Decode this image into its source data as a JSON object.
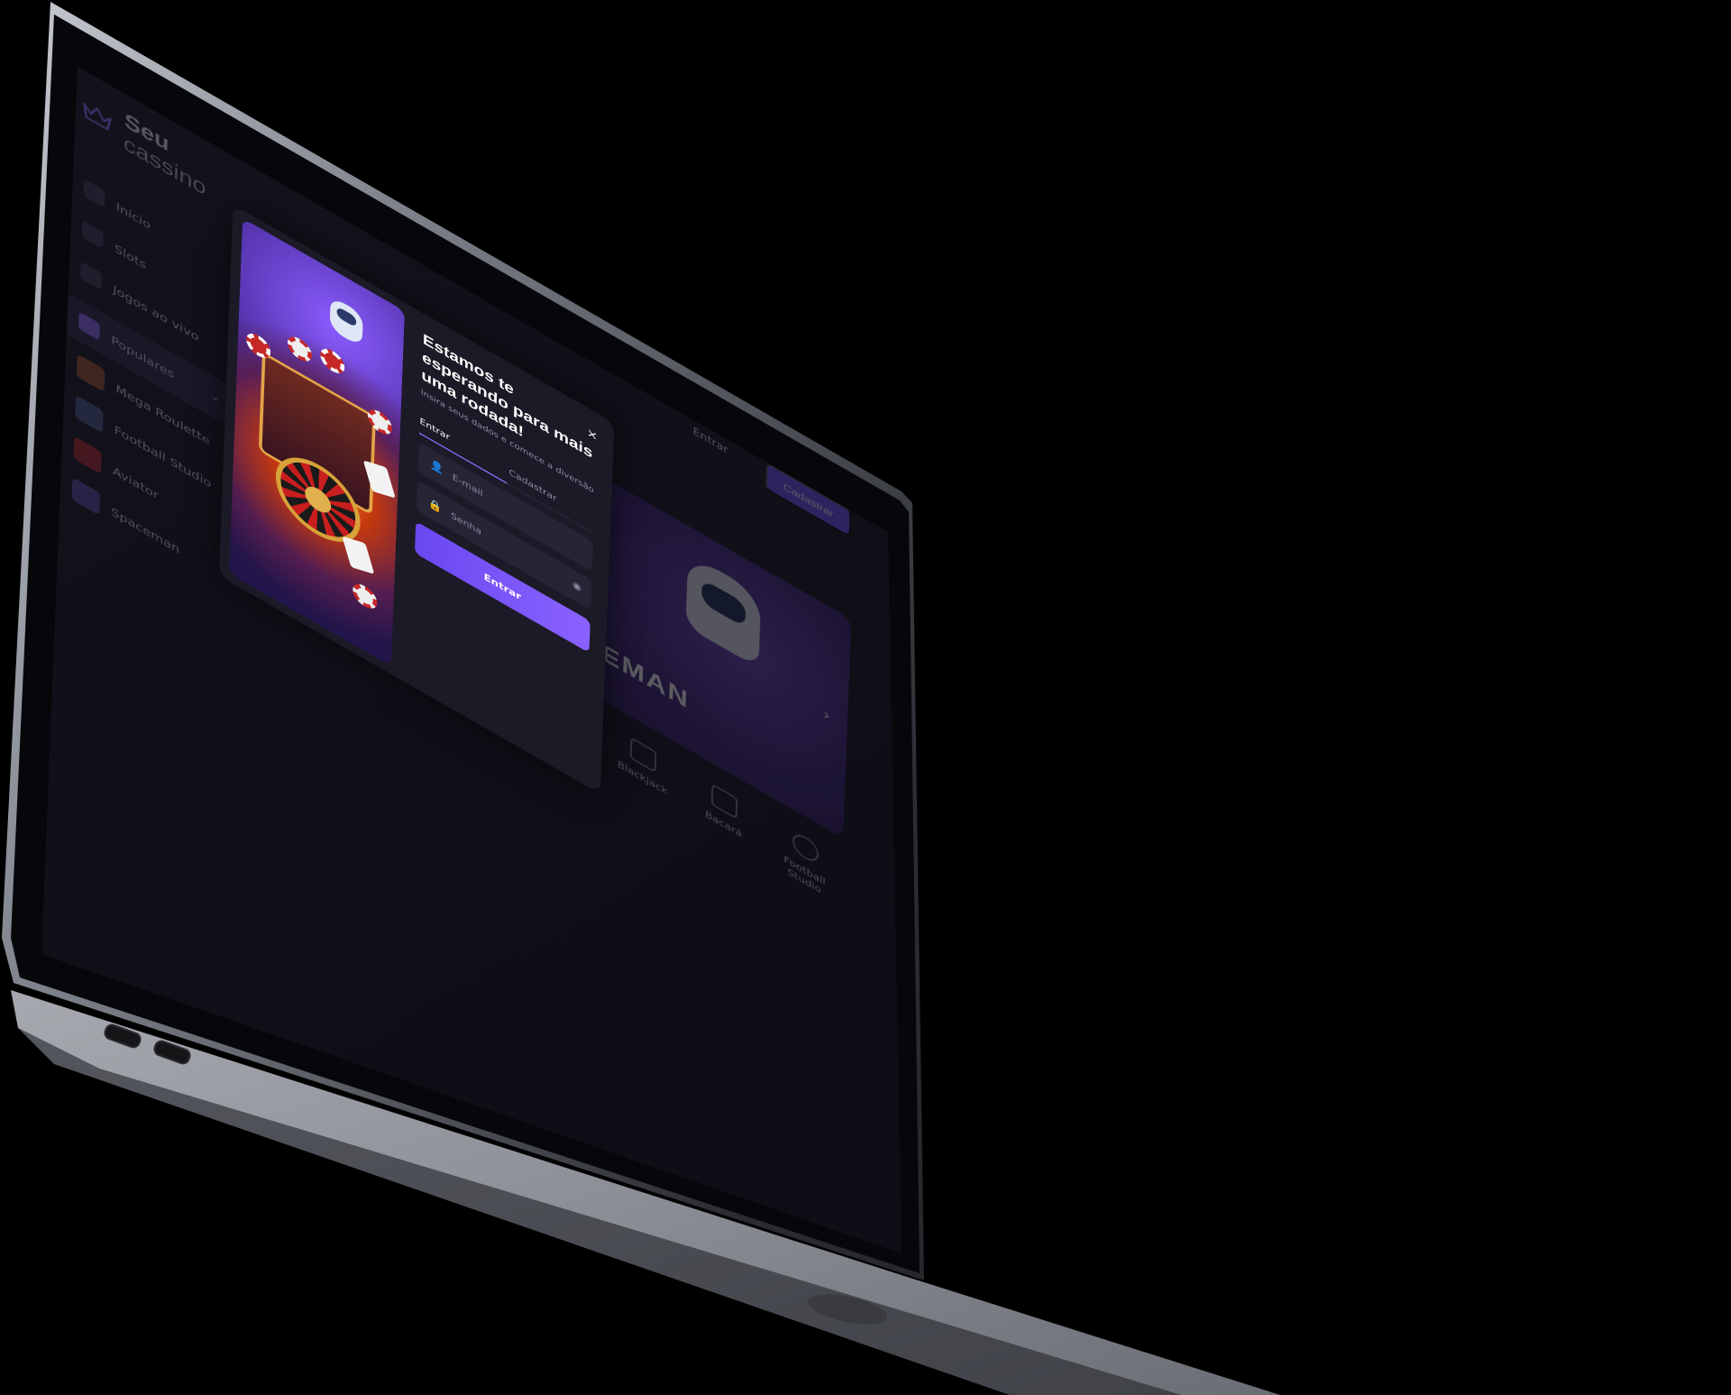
{
  "brand": {
    "name_bold": "Seu",
    "name_light": "cassino",
    "logo_icon": "crown-icon"
  },
  "header": {
    "login_label": "Entrar",
    "signup_label": "Cadastrar"
  },
  "sidebar": {
    "items": [
      {
        "label": "Início",
        "icon": "home-icon"
      },
      {
        "label": "Slots",
        "icon": "slots-icon"
      },
      {
        "label": "Jogos ao vivo",
        "icon": "live-icon"
      },
      {
        "label": "Populares",
        "icon": "star-icon",
        "active": true
      },
      {
        "label": "Mega Roulette",
        "icon": "game-thumb"
      },
      {
        "label": "Football Studio",
        "icon": "game-thumb"
      },
      {
        "label": "Aviator",
        "icon": "game-thumb"
      },
      {
        "label": "Spaceman",
        "icon": "game-thumb"
      }
    ]
  },
  "hero": {
    "title": "SPACEMAN"
  },
  "categories": [
    {
      "label": "Blackjack",
      "icon": "cards-icon"
    },
    {
      "label": "Bacará",
      "icon": "card-icon"
    },
    {
      "label": "Football Studio",
      "icon": "ball-icon"
    }
  ],
  "modal": {
    "title": "Estamos te esperando para mais uma rodada!",
    "subtitle": "Insira seus dados e comece a diversão",
    "tabs": {
      "login": "Entrar",
      "signup": "Cadastrar",
      "active": "login"
    },
    "email_placeholder": "E-mail",
    "password_placeholder": "Senha",
    "submit_label": "Entrar",
    "close_symbol": "×"
  },
  "colors": {
    "accent": "#8f6bff",
    "button": "#6d4df5",
    "panel": "#1b1a26",
    "field": "#262435"
  }
}
